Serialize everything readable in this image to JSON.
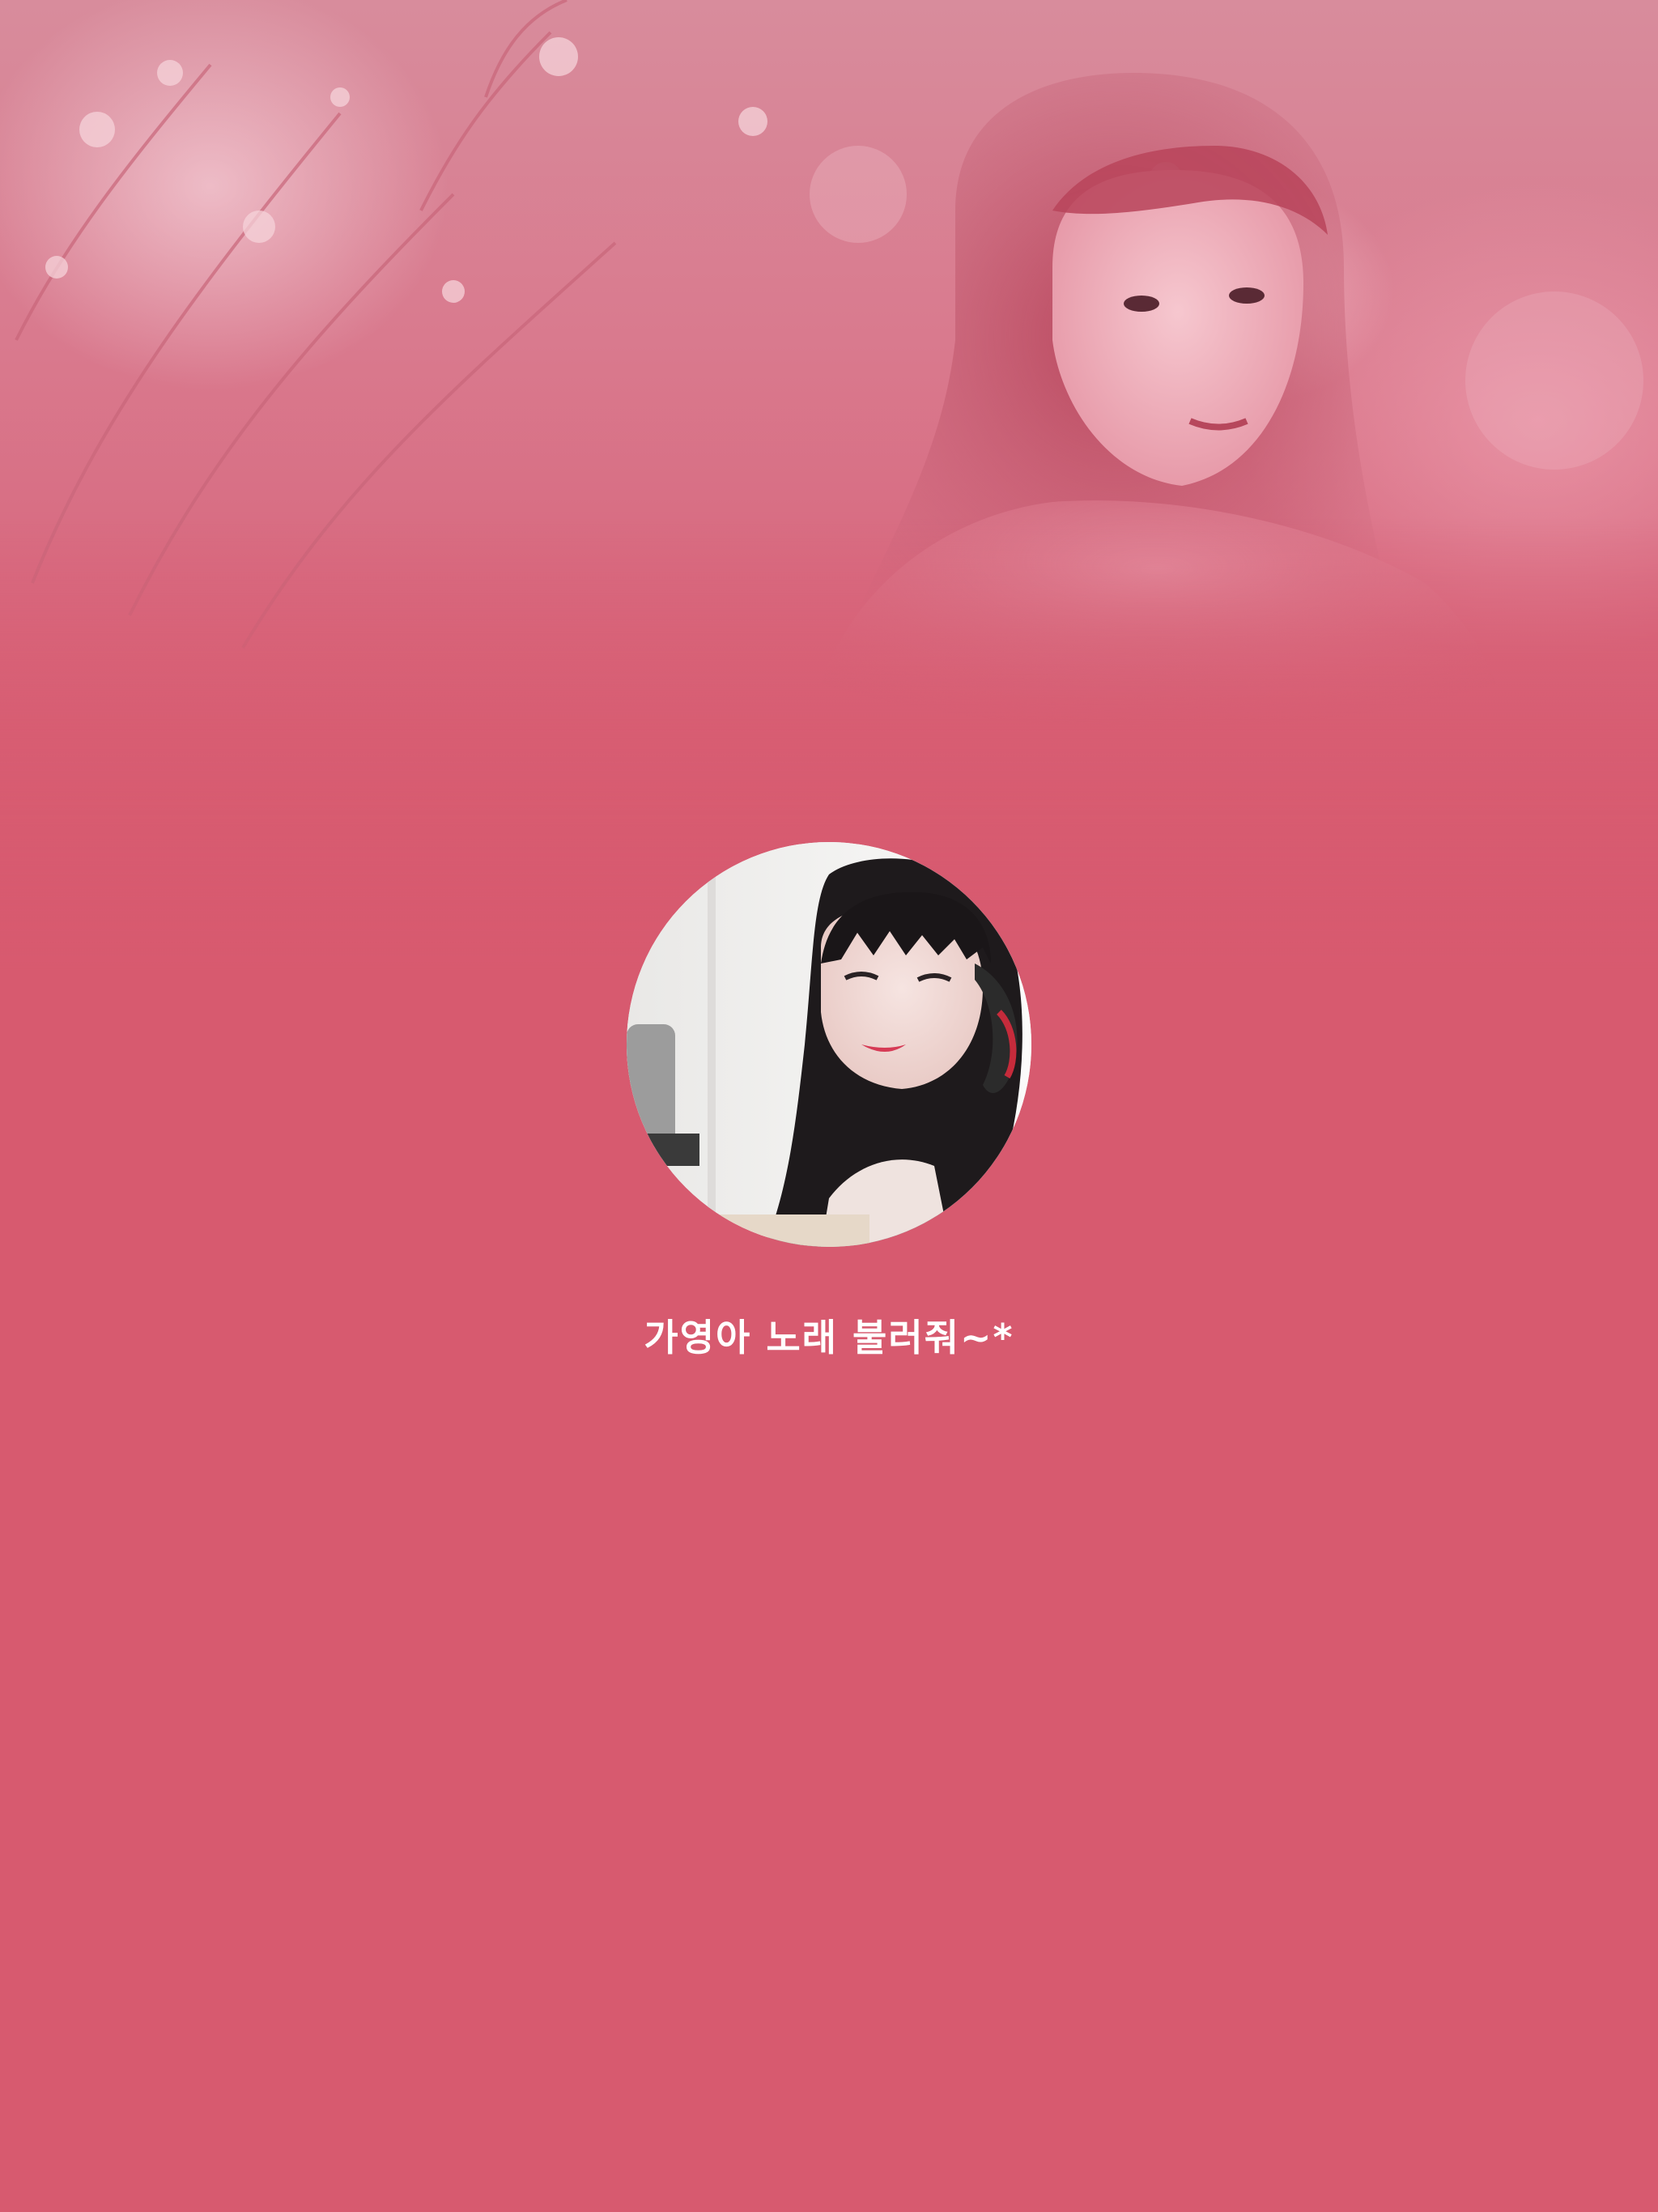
{
  "theme": {
    "background": "#d75a6f",
    "title_color": "#ffffff"
  },
  "cover": {
    "description_icon": "cover-photo"
  },
  "profile": {
    "avatar_icon": "profile-photo",
    "title": "가영아 노래 불러줘~*"
  }
}
